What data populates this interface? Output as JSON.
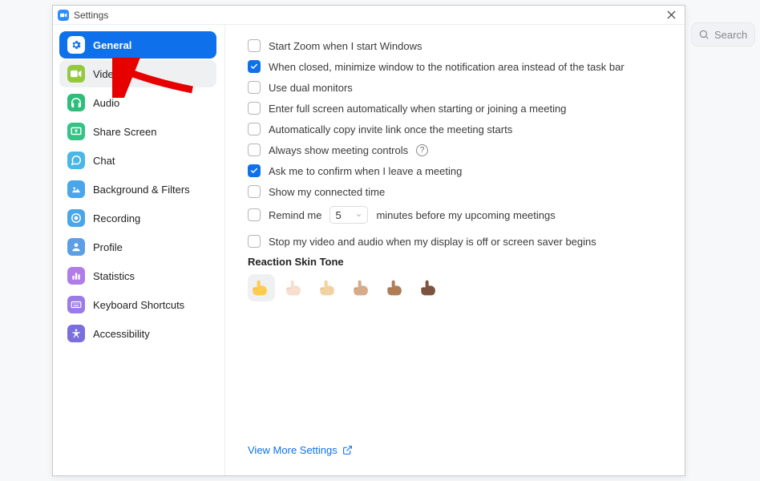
{
  "titlebar": {
    "title": "Settings"
  },
  "bg_search": {
    "placeholder": "Search"
  },
  "sidebar": {
    "items": [
      {
        "label": "General",
        "active": true,
        "hovered": false,
        "icon": "gear",
        "bg": "#ffffff",
        "fg": "#0e71eb"
      },
      {
        "label": "Video",
        "active": false,
        "hovered": true,
        "icon": "video",
        "bg": "#95c93d",
        "fg": "#ffffff"
      },
      {
        "label": "Audio",
        "active": false,
        "hovered": false,
        "icon": "headphones",
        "bg": "#2ebd7a",
        "fg": "#ffffff"
      },
      {
        "label": "Share Screen",
        "active": false,
        "hovered": false,
        "icon": "share",
        "bg": "#34c285",
        "fg": "#ffffff"
      },
      {
        "label": "Chat",
        "active": false,
        "hovered": false,
        "icon": "chat",
        "bg": "#4ab7e6",
        "fg": "#ffffff"
      },
      {
        "label": "Background & Filters",
        "active": false,
        "hovered": false,
        "icon": "image",
        "bg": "#4aa6ea",
        "fg": "#ffffff"
      },
      {
        "label": "Recording",
        "active": false,
        "hovered": false,
        "icon": "record",
        "bg": "#4aa6ea",
        "fg": "#ffffff"
      },
      {
        "label": "Profile",
        "active": false,
        "hovered": false,
        "icon": "user",
        "bg": "#5c9fe6",
        "fg": "#ffffff"
      },
      {
        "label": "Statistics",
        "active": false,
        "hovered": false,
        "icon": "stats",
        "bg": "#b07ce8",
        "fg": "#ffffff"
      },
      {
        "label": "Keyboard Shortcuts",
        "active": false,
        "hovered": false,
        "icon": "keyboard",
        "bg": "#9b7be6",
        "fg": "#ffffff"
      },
      {
        "label": "Accessibility",
        "active": false,
        "hovered": false,
        "icon": "accessibility",
        "bg": "#7a6fdc",
        "fg": "#ffffff"
      }
    ]
  },
  "general": {
    "options": {
      "start_with_windows": {
        "label": "Start Zoom when I start Windows",
        "checked": false
      },
      "minimize_to_tray": {
        "label": "When closed, minimize window to the notification area instead of the task bar",
        "checked": true
      },
      "dual_monitors": {
        "label": "Use dual monitors",
        "checked": false
      },
      "enter_fullscreen": {
        "label": "Enter full screen automatically when starting or joining a meeting",
        "checked": false
      },
      "copy_invite_link": {
        "label": "Automatically copy invite link once the meeting starts",
        "checked": false
      },
      "show_controls": {
        "label": "Always show meeting controls",
        "checked": false,
        "has_help": true
      },
      "confirm_leave": {
        "label": "Ask me to confirm when I leave a meeting",
        "checked": true
      },
      "connected_time": {
        "label": "Show my connected time",
        "checked": false
      },
      "remind": {
        "label_pre": "Remind me",
        "value": "5",
        "label_post": "minutes before my upcoming meetings",
        "checked": false
      },
      "stop_on_screensaver": {
        "label": "Stop my video and audio when my display is off or screen saver begins",
        "checked": false
      }
    },
    "skin_tone_label": "Reaction Skin Tone",
    "skin_tones": [
      "#ffcc4d",
      "#f7dece",
      "#f3d2a2",
      "#d5ab88",
      "#af7e57",
      "#7c533e"
    ],
    "skin_tone_selected": 0,
    "view_more": "View More Settings"
  }
}
